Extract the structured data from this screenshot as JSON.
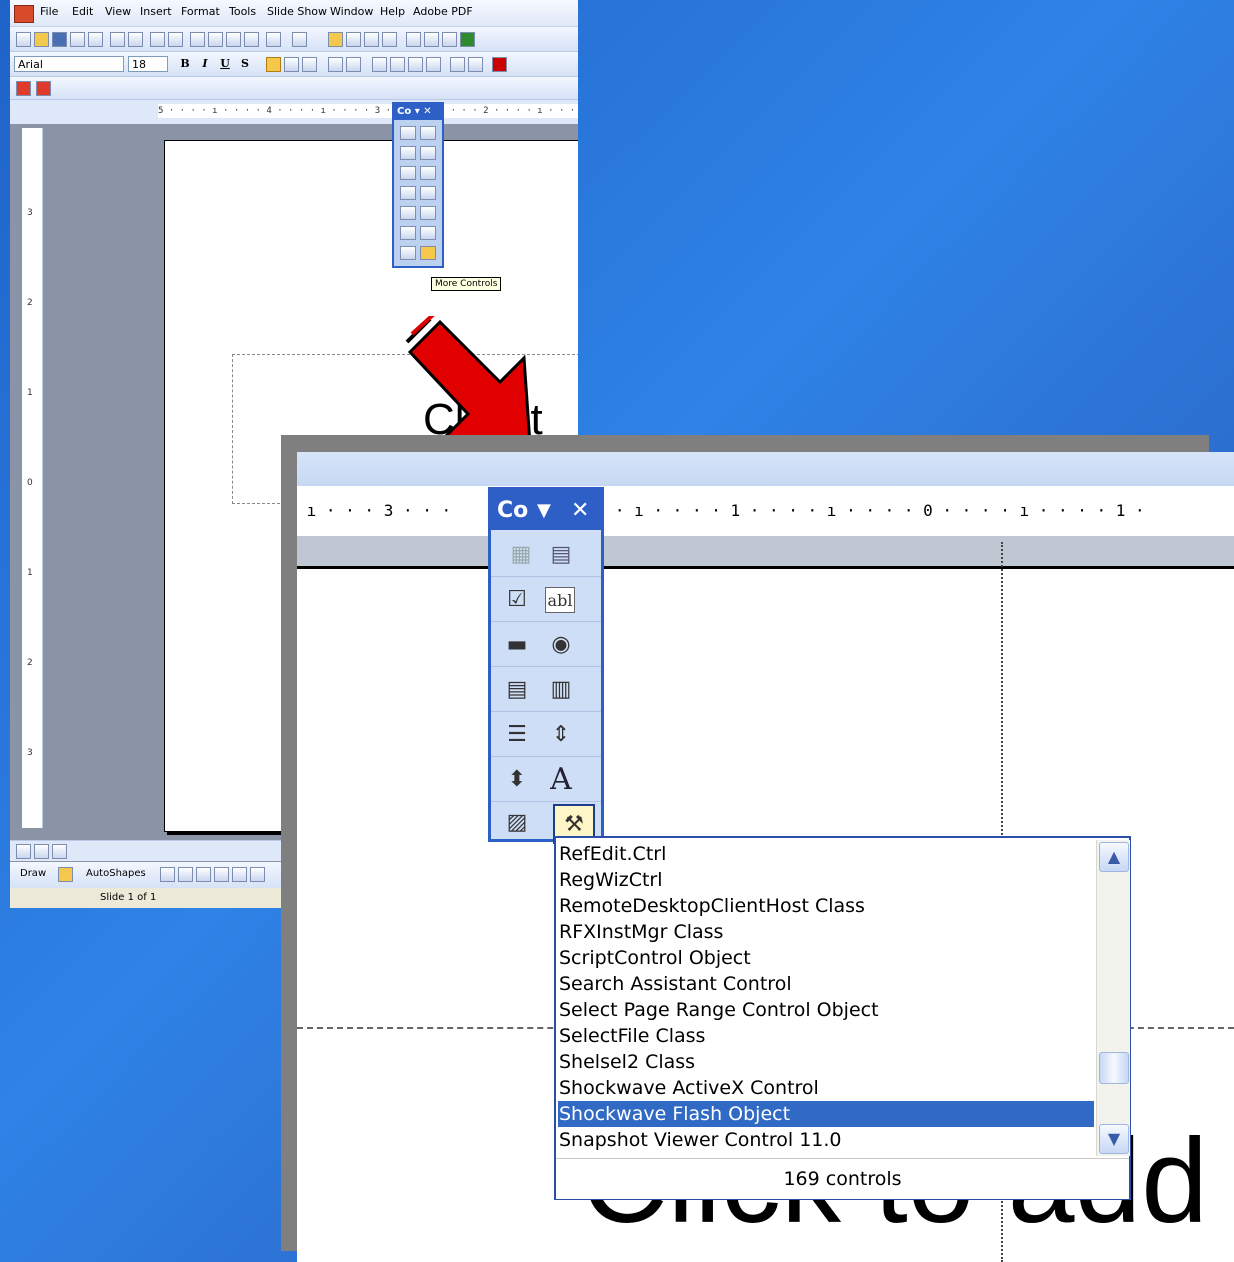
{
  "small_window": {
    "menu": [
      "File",
      "Edit",
      "View",
      "Insert",
      "Format",
      "Tools",
      "Slide Show",
      "Window",
      "Help",
      "Adobe PDF"
    ],
    "font_name": "Arial",
    "font_size": "18",
    "format_buttons": [
      "B",
      "I",
      "U",
      "S"
    ],
    "ruler_text": "5 · · · · ı · · · · 4 · · · · ı · · · · 3 · · · · ı · · · · 2 · · · · ı · · · · 1 · · · · ı · · · ·",
    "vruler_marks": [
      "3",
      "2",
      "1",
      "0",
      "1",
      "2",
      "3"
    ],
    "control_toolbox_title": "Co",
    "tooltip": "More Controls",
    "slide_text": "Click t",
    "draw_menu": "Draw",
    "autoshapes": "AutoShapes",
    "status": "Slide 1 of 1"
  },
  "zoom_panel": {
    "ruler_text": " ı · · · 3 · · ·         2 · · · · ı · · · · 1 · · · · ı · · · · 0 · · · · ı · · · · 1 ·",
    "control_toolbox_title": "Co",
    "slide_text": "Click to add",
    "list_items": [
      "RefEdit.Ctrl",
      "RegWizCtrl",
      "RemoteDesktopClientHost Class",
      "RFXInstMgr Class",
      "ScriptControl Object",
      "Search Assistant Control",
      "Select Page Range Control Object",
      "SelectFile Class",
      "Shelsel2 Class",
      "Shockwave ActiveX Control",
      "Shockwave Flash Object",
      "Snapshot Viewer Control 11.0"
    ],
    "selected_item": "Shockwave Flash Object",
    "control_count": "169 controls"
  },
  "colors": {
    "background": "#2a72d8",
    "toolbox_title": "#2d5fc7",
    "selection": "#316ac5",
    "arrow": "#e00000"
  },
  "icons": {
    "arrow": "red-down-right-arrow-icon",
    "more_controls": "hammer-wrench-icon"
  }
}
